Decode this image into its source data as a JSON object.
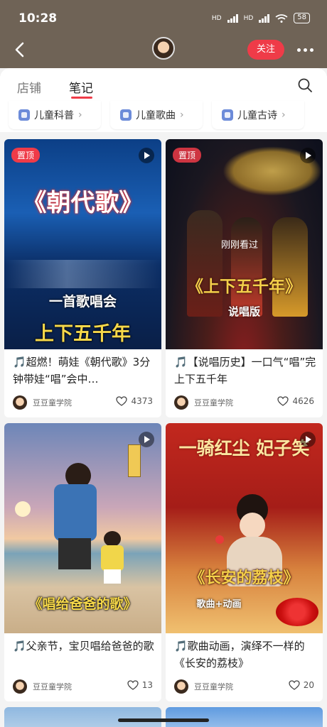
{
  "status": {
    "time": "10:28",
    "battery": "58",
    "hd1": "HD",
    "hd2": "HD"
  },
  "header": {
    "follow_label": "关注"
  },
  "tabs": [
    {
      "label": "店铺"
    },
    {
      "label": "笔记"
    }
  ],
  "chips": [
    {
      "label": "儿童科普"
    },
    {
      "label": "儿童歌曲"
    },
    {
      "label": "儿童古诗"
    }
  ],
  "cards": [
    {
      "pinned": "置顶",
      "art_title": "《朝代歌》",
      "art_sub": "一首歌唱会",
      "art_big": "上下五千年",
      "title": "🎵超燃！萌娃《朝代歌》3分钟带娃“唱”会中…",
      "author": "豆豆童学院",
      "likes": "4373"
    },
    {
      "pinned": "置顶",
      "art_title": "《上下五千年》",
      "art_sub": "说唱版",
      "seen": "刚刚看过",
      "title": "🎵【说唱历史】一口气“唱”完上下五千年",
      "author": "豆豆童学院",
      "likes": "4626"
    },
    {
      "art_title": "《唱给爸爸的歌》",
      "title": "🎵父亲节，宝贝唱给爸爸的歌",
      "author": "豆豆童学院",
      "likes": "13"
    },
    {
      "art_top": "一骑红尘 妃子笑",
      "art_title": "《长安的荔枝》",
      "art_sub": "歌曲+动画",
      "title": "🎵歌曲动画，演绎不一样的《长安的荔枝》",
      "author": "豆豆童学院",
      "likes": "20"
    }
  ]
}
